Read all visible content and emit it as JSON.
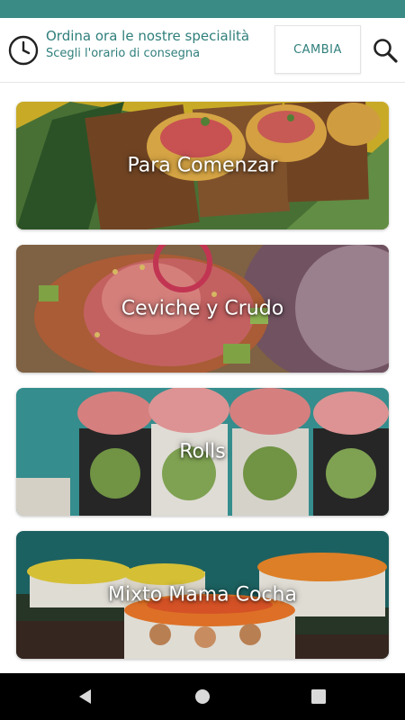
{
  "header": {
    "title": "Ordina ora le nostre specialità",
    "subtitle": "Scegli l'orario di consegna",
    "change_button_label": "CAMBIA",
    "icons": {
      "clock": "clock-icon",
      "search": "search-icon"
    }
  },
  "categories": [
    {
      "label": "Para Comenzar"
    },
    {
      "label": "Ceviche y Crudo"
    },
    {
      "label": "Rolls"
    },
    {
      "label": "Mixto Mama Cocha"
    }
  ],
  "nav": {
    "icons": [
      "back-icon",
      "home-icon",
      "recents-icon"
    ]
  },
  "colors": {
    "accent": "#2f7f7b",
    "status_bar": "#3a8a86",
    "nav_bar": "#000000"
  }
}
